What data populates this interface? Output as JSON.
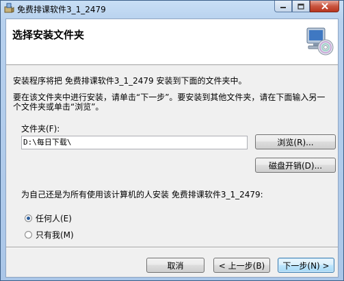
{
  "window": {
    "title": "免费排课软件3_1_2479",
    "controls": {
      "minimize": "minimize",
      "maximize": "maximize",
      "close": "close"
    }
  },
  "banner": {
    "title": "选择安装文件夹",
    "icon": "setup-computer-cd-icon"
  },
  "text": {
    "line1": "安装程序将把 免费排课软件3_1_2479 安装到下面的文件夹中。",
    "line2": "要在该文件夹中进行安装，请单击“下一步”。要安装到其他文件夹，请在下面输入另一",
    "line3": "个文件夹或单击“浏览”。"
  },
  "folder": {
    "label": "文件夹(F):",
    "value": "D:\\每日下载\\",
    "browse_label": "浏览(R)...",
    "disk_cost_label": "磁盘开销(D)..."
  },
  "install_for": {
    "question": "为自己还是为所有使用该计算机的人安装 免费排课软件3_1_2479:",
    "options": [
      {
        "label": "任何人(E)",
        "checked": true
      },
      {
        "label": "只有我(M)",
        "checked": false
      }
    ]
  },
  "footer": {
    "cancel_label": "取消",
    "back_label": "< 上一步(B)",
    "next_label": "下一步(N) >"
  }
}
